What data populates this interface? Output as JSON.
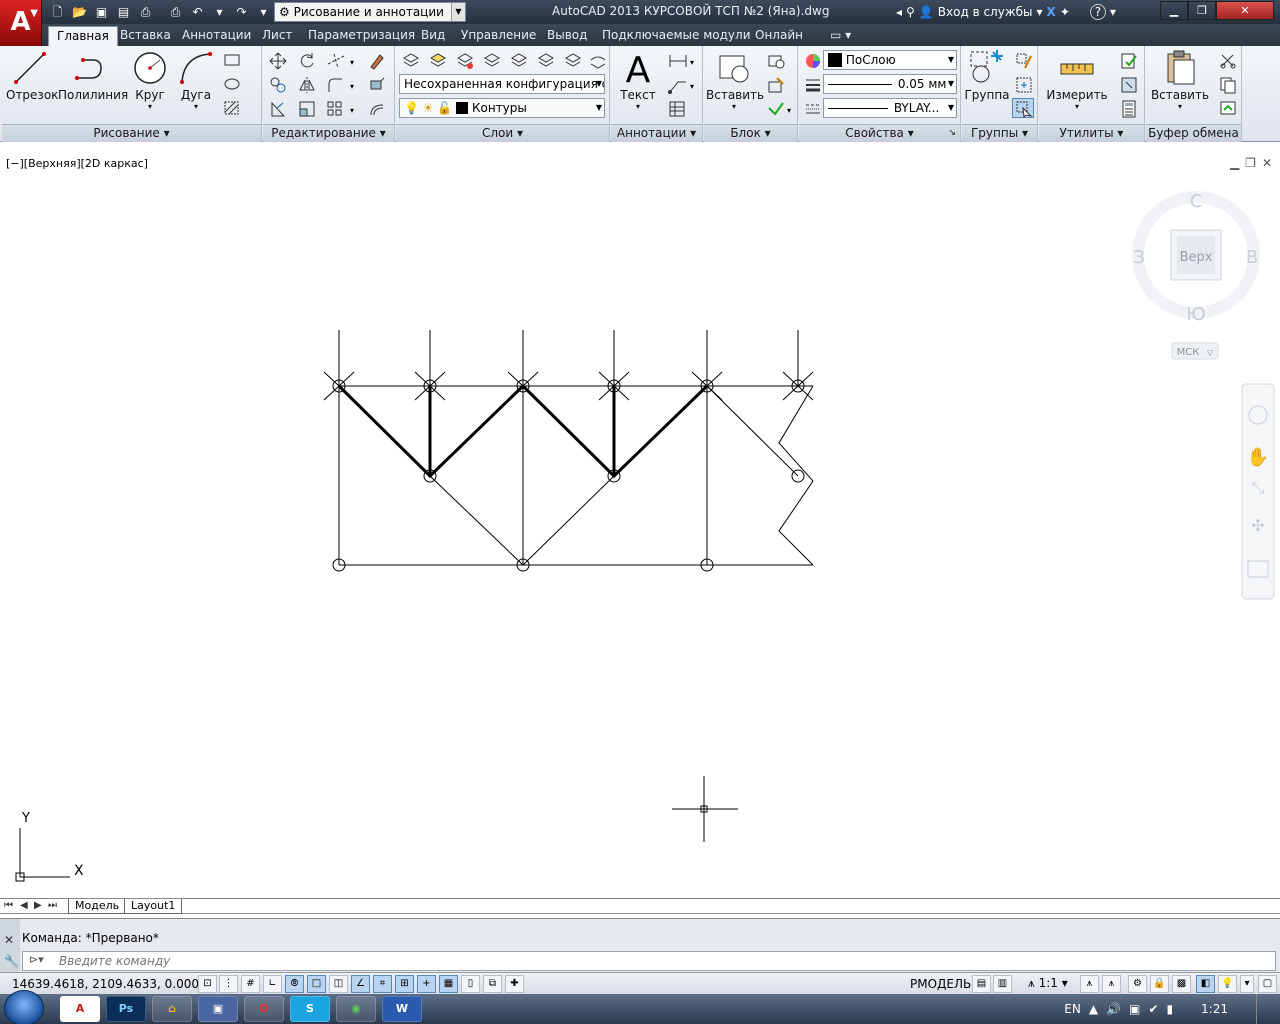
{
  "app": {
    "logo_letter": "A",
    "workspace": "Рисование и аннотации",
    "window_title": "AutoCAD 2013    КУРСОВОЙ ТСП №2 (Яна).dwg",
    "sign_in": "Вход в службы",
    "help": "?"
  },
  "tabs": [
    {
      "label": "Главная",
      "active": true
    },
    {
      "label": "Вставка"
    },
    {
      "label": "Аннотации"
    },
    {
      "label": "Лист"
    },
    {
      "label": "Параметризация"
    },
    {
      "label": "Вид"
    },
    {
      "label": "Управление"
    },
    {
      "label": "Вывод"
    },
    {
      "label": "Подключаемые модули"
    },
    {
      "label": "Онлайн"
    }
  ],
  "ribbon": {
    "draw": {
      "title": "Рисование",
      "line": "Отрезок",
      "polyline": "Полилиния",
      "circle": "Круг",
      "arc": "Дуга"
    },
    "modify": {
      "title": "Редактирование"
    },
    "layers": {
      "title": "Слои",
      "layer_state": "Несохраненная конфигурация сло",
      "current_layer": "Контуры"
    },
    "annotation": {
      "title": "Аннотации",
      "text": "Текст"
    },
    "block": {
      "title": "Блок",
      "insert": "Вставить"
    },
    "properties": {
      "title": "Свойства",
      "color": "ПоСлою",
      "lineweight": "0.05 мм",
      "linetype": "BYLAY..."
    },
    "groups": {
      "title": "Группы",
      "group": "Группа"
    },
    "utilities": {
      "title": "Утилиты",
      "measure": "Измерить"
    },
    "clipboard": {
      "title": "Буфер обмена",
      "paste": "Вставить"
    }
  },
  "viewport": {
    "label": "[−][Верхняя][2D каркас]",
    "viewcube": {
      "north": "С",
      "south": "Ю",
      "west": "З",
      "east": "В",
      "face": "Верх",
      "ucs": "МСК"
    },
    "ucs_x": "X",
    "ucs_y": "Y"
  },
  "layout_tabs": [
    "Модель",
    "Layout1"
  ],
  "command": {
    "history": "Команда:  *Прервано*",
    "placeholder": "Введите команду"
  },
  "status": {
    "coords": "14639.4618, 2109.4633, 0.0000",
    "model": "РМОДЕЛЬ",
    "scale": "1:1"
  },
  "taskbar": {
    "lang": "EN",
    "clock": "1:21",
    "apps": [
      "A",
      "Ps",
      "⌂",
      "▣",
      "O",
      "S",
      "◉",
      "W"
    ]
  },
  "colors": {
    "accent": "#c81b1b",
    "ribbon_bg": "#e6ebf1"
  }
}
